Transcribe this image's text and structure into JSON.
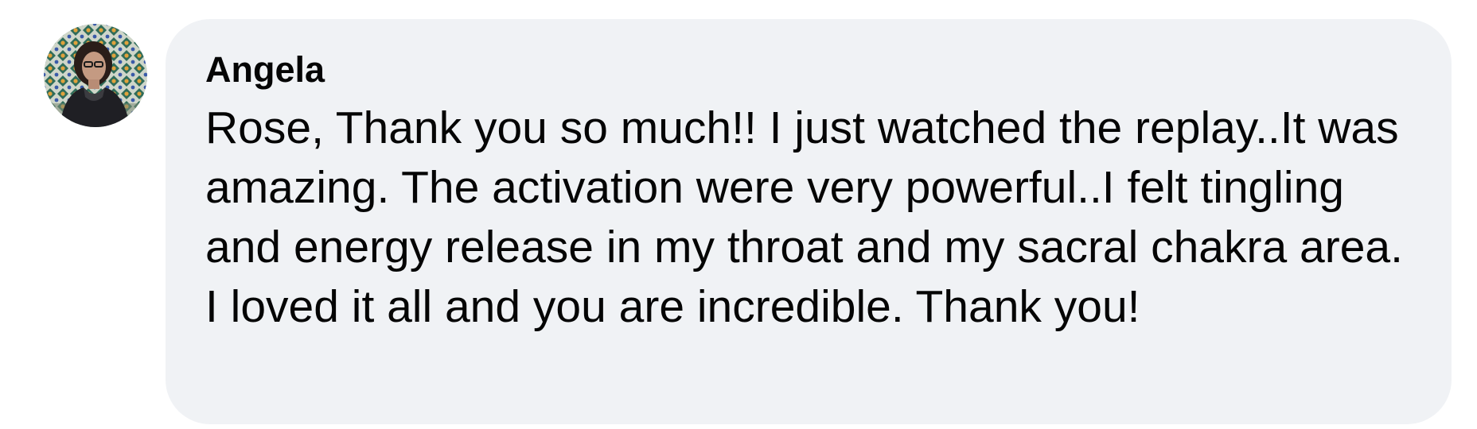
{
  "comment": {
    "avatar_icon": "user-avatar-photo",
    "author": "Angela",
    "text": "Rose, Thank you so much!! I just watched the replay..It was amazing. The activation were very powerful..I felt tingling and energy release in my throat and my sacral chakra area. I loved it all and you are incredible. Thank you!"
  },
  "colors": {
    "bubble_background": "#f0f2f5",
    "text": "#050505"
  }
}
